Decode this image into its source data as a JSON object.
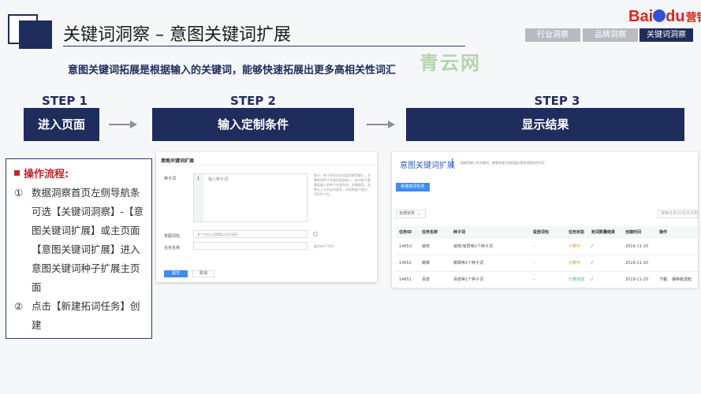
{
  "header": {
    "title": "关键词洞察 – 意图关键词扩展",
    "logo": {
      "bai": "Bai",
      "du": "du",
      "suffix": "营销"
    },
    "tabs": [
      {
        "label": "行业洞察",
        "active": false
      },
      {
        "label": "品牌洞察",
        "active": false
      },
      {
        "label": "关键词洞察",
        "active": true
      }
    ],
    "watermark": "青云网",
    "subtitle": "意图关键词拓展是根据输入的关键词，能够快速拓展出更多高相关性词汇"
  },
  "steps": [
    {
      "label": "STEP 1",
      "box": "进入页面"
    },
    {
      "label": "STEP 2",
      "box": "输入定制条件"
    },
    {
      "label": "STEP 3",
      "box": "显示结果"
    }
  ],
  "process": {
    "heading": "操作流程:",
    "items": [
      {
        "num": "①",
        "text": "数据洞察首页左侧导航条可选【关键词洞察】-【意图关键词扩展】或主页面【意图关键词扩展】进入意图关键词种子扩展主页面"
      },
      {
        "num": "②",
        "text": "点击【新建拓词任务】创建"
      }
    ]
  },
  "form_screenshot": {
    "title": "意图关键词扩展",
    "seed_label": "种子词",
    "seed_line_no": "1",
    "seed_placeholder": "输入种子词",
    "hint_text": "提示：种子词的包含词类别都是输入，并需按照种子词类别批量录入，新词条不要重复输入的种子词会合并，如需使用，选择以上方对应的类型，词条数量不超过5000个/词。",
    "intent_label": "意图词包",
    "intent_placeholder": "多个词包之间需要以逗号隔开",
    "task_label": "任务名称",
    "task_hint": "最多80个字符",
    "submit_label": "提交",
    "cancel_label": "取消",
    "colors": {
      "primary": "#3f8bf0"
    }
  },
  "result_screenshot": {
    "title": "意图关键词扩展",
    "desc": "根据您输入的关键词，能够快速为您拓展出更多高相关性词汇",
    "new_button": "新建拓词任务",
    "filter": "全部状态",
    "search_placeholder": "搜索任务ID/任务名称",
    "columns": [
      "任务ID",
      "任务名称",
      "种子词",
      "投放词包",
      "任务状态",
      "拓词数量结果",
      "创建时间",
      "操作"
    ],
    "rows": [
      {
        "id": "14653",
        "name": "装修",
        "seed": "装修/家居等2个种子词",
        "pkg": "–",
        "status": "计算中",
        "count": "/",
        "date": "2019-11-20",
        "ops": []
      },
      {
        "id": "14652",
        "name": "螺蛳",
        "seed": "螺蛳等1个种子词",
        "pkg": "–",
        "status": "计算中",
        "count": "/",
        "date": "2019-11-20",
        "ops": []
      },
      {
        "id": "14651",
        "name": "百度",
        "seed": "百度等1个种子词",
        "pkg": "–",
        "status": "计算完成",
        "count": "/",
        "date": "2019-11-20",
        "ops": [
          "下载",
          "保存拓词包"
        ]
      }
    ],
    "colors": {
      "computing": "#f0941c",
      "done": "#42b983"
    }
  }
}
